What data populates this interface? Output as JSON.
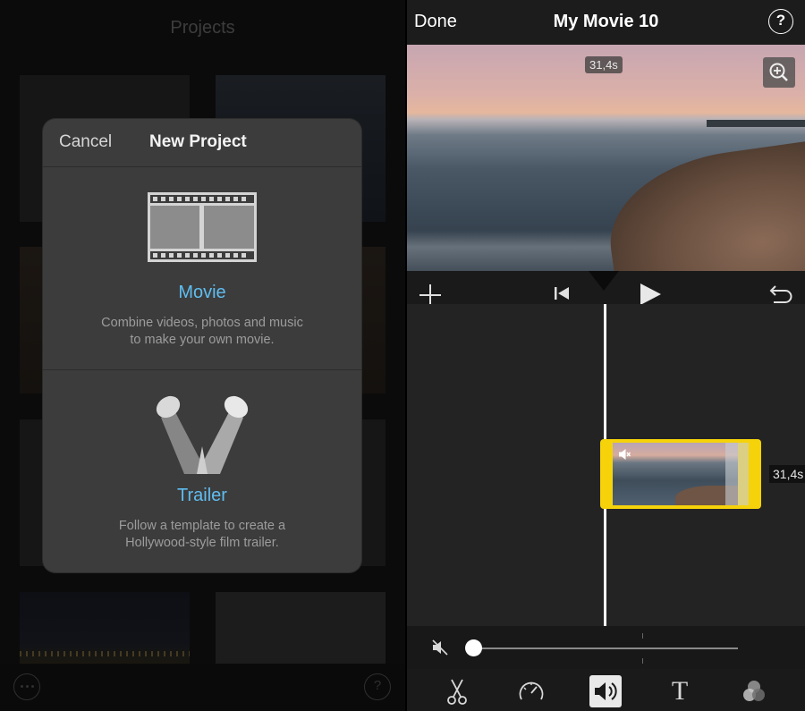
{
  "projects_screen": {
    "title": "Projects"
  },
  "new_project_dialog": {
    "cancel_label": "Cancel",
    "title": "New Project",
    "options": [
      {
        "label": "Movie",
        "description": "Combine videos, photos and music to make your own movie."
      },
      {
        "label": "Trailer",
        "description": "Follow a template to create a Hollywood-style film trailer."
      }
    ]
  },
  "editor": {
    "done_label": "Done",
    "movie_title": "My Movie 10",
    "help_label": "?",
    "preview_duration": "31,4s",
    "clip_duration": "31,4s",
    "clip_muted": true,
    "volume_level": 0,
    "active_tool": "volume"
  },
  "colors": {
    "accent": "#5fbdf0",
    "clip_selection": "#f5d20a",
    "panel_bg": "#1f1f1f",
    "dialog_bg": "#3c3c3c"
  }
}
